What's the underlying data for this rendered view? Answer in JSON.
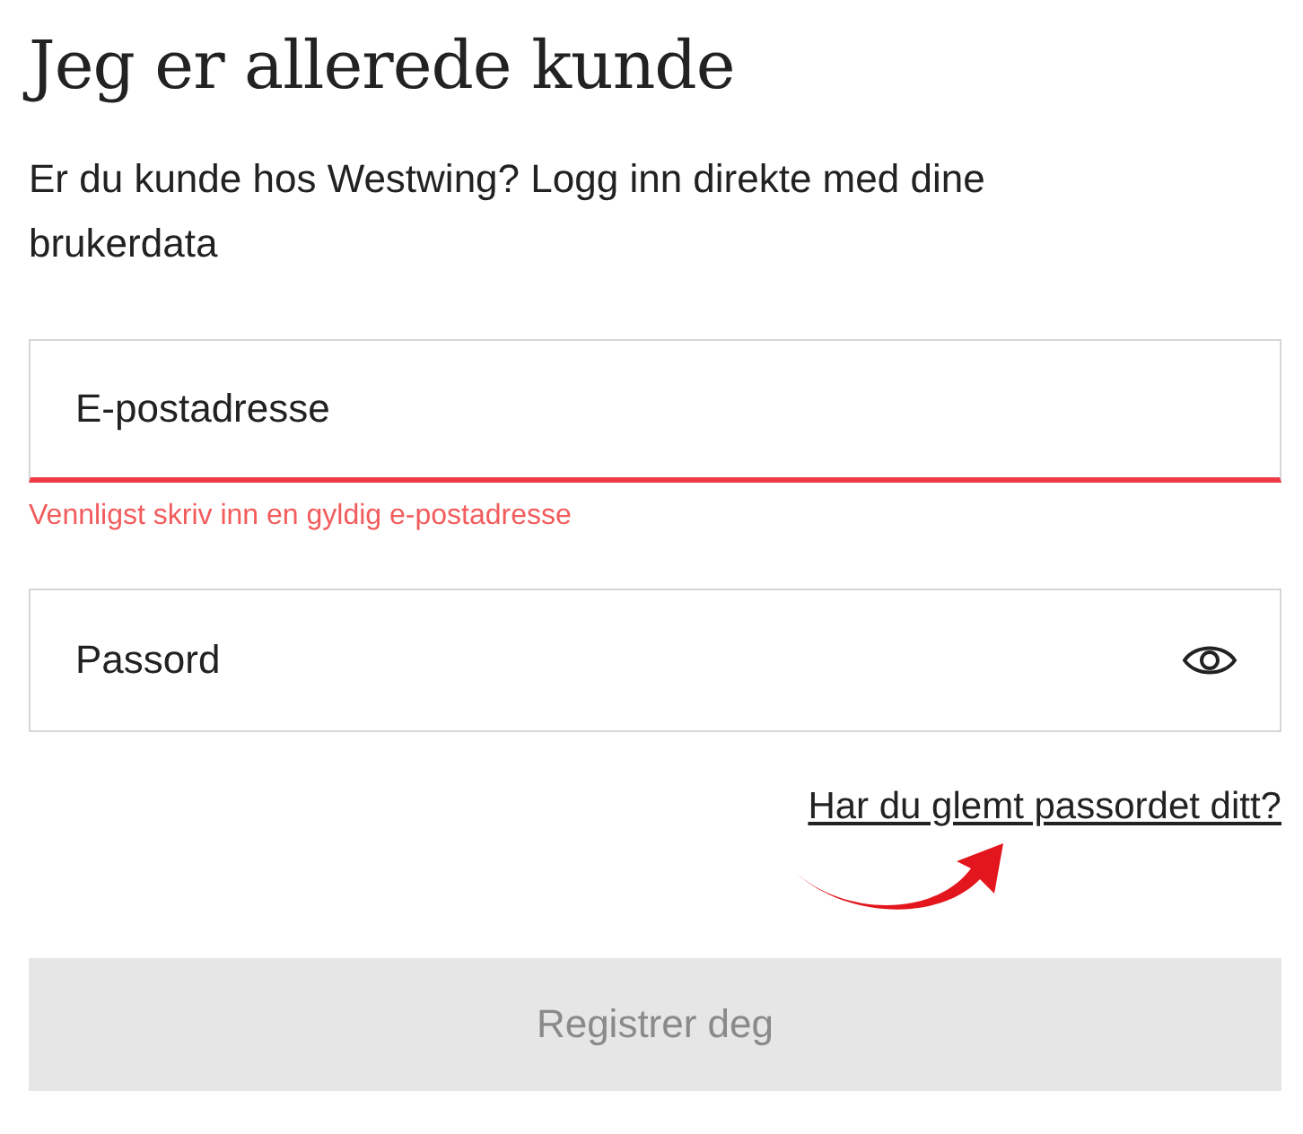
{
  "title": "Jeg er allerede kunde",
  "intro": "Er du kunde hos Westwing? Logg inn direkte med dine brukerdata",
  "email": {
    "placeholder": "E-postadresse",
    "invalid": true,
    "error": "Vennligst skriv inn en gyldig e-postadresse"
  },
  "password": {
    "placeholder": "Passord"
  },
  "forgot_link": "Har du glemt passordet ditt?",
  "submit": {
    "label": "Registrer deg",
    "disabled": true
  }
}
